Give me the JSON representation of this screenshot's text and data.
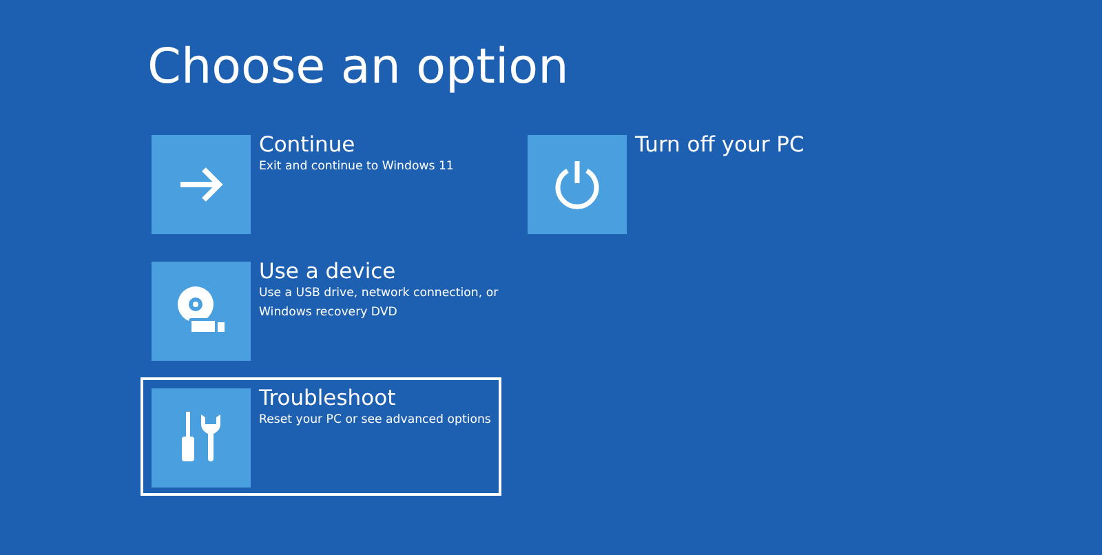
{
  "title": "Choose an option",
  "columns": [
    {
      "options": [
        {
          "kind": "arrow",
          "label": "Continue",
          "description": "Exit and continue to Windows 11",
          "selected": false
        },
        {
          "kind": "device",
          "label": "Use a device",
          "description": "Use a USB drive, network connection, or Windows recovery DVD",
          "selected": false
        },
        {
          "kind": "tools",
          "label": "Troubleshoot",
          "description": "Reset your PC or see advanced options",
          "selected": true
        }
      ]
    },
    {
      "options": [
        {
          "kind": "power",
          "label": "Turn off your PC",
          "selected": false
        }
      ]
    }
  ]
}
